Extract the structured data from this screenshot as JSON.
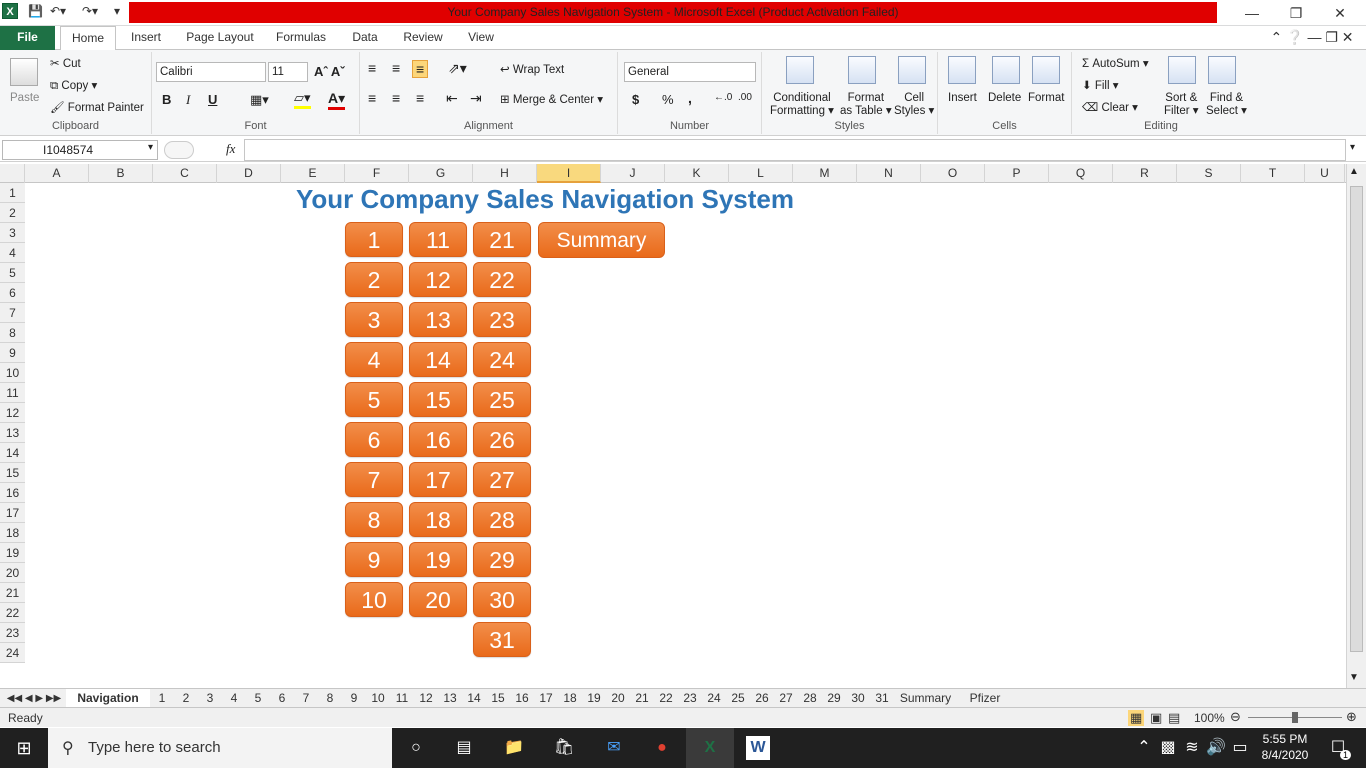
{
  "window": {
    "title": "Your Company Sales Navigation System  -  Microsoft Excel (Product Activation Failed)"
  },
  "tabs": [
    "File",
    "Home",
    "Insert",
    "Page Layout",
    "Formulas",
    "Data",
    "Review",
    "View"
  ],
  "ribbon": {
    "clipboard": {
      "label": "Clipboard",
      "paste": "Paste",
      "cut": "Cut",
      "copy": "Copy",
      "format_painter": "Format Painter"
    },
    "font": {
      "label": "Font",
      "name": "Calibri",
      "size": "11",
      "bold": "B",
      "italic": "I",
      "underline": "U"
    },
    "alignment": {
      "label": "Alignment",
      "wrap_text": "Wrap Text",
      "merge_center": "Merge & Center"
    },
    "number": {
      "label": "Number",
      "format": "General",
      "currency": "$",
      "percent": "%",
      "comma": ","
    },
    "styles": {
      "label": "Styles",
      "conditional": "Conditional",
      "formatting": "Formatting",
      "format_as": "Format",
      "as_table": "as Table",
      "cell": "Cell",
      "styles": "Styles"
    },
    "cells": {
      "label": "Cells",
      "insert": "Insert",
      "delete": "Delete",
      "format": "Format"
    },
    "editing": {
      "label": "Editing",
      "autosum": "AutoSum",
      "fill": "Fill",
      "clear": "Clear",
      "sort": "Sort &",
      "filter": "Filter",
      "find": "Find &",
      "select": "Select"
    }
  },
  "formula_bar": {
    "name_box": "I1048574",
    "fx": "fx",
    "formula": ""
  },
  "columns": [
    "A",
    "B",
    "C",
    "D",
    "E",
    "F",
    "G",
    "H",
    "I",
    "J",
    "K",
    "L",
    "M",
    "N",
    "O",
    "P",
    "Q",
    "R",
    "S",
    "T",
    "U"
  ],
  "selected_column": "I",
  "rows": [
    "1",
    "2",
    "3",
    "4",
    "5",
    "6",
    "7",
    "8",
    "9",
    "10",
    "11",
    "12",
    "13",
    "14",
    "15",
    "16",
    "17",
    "18",
    "19",
    "20",
    "21",
    "22",
    "23",
    "24"
  ],
  "sheet": {
    "title": "Your Company Sales Navigation System",
    "summary_button": "Summary",
    "col1": [
      "1",
      "2",
      "3",
      "4",
      "5",
      "6",
      "7",
      "8",
      "9",
      "10"
    ],
    "col2": [
      "11",
      "12",
      "13",
      "14",
      "15",
      "16",
      "17",
      "18",
      "19",
      "20"
    ],
    "col3": [
      "21",
      "22",
      "23",
      "24",
      "25",
      "26",
      "27",
      "28",
      "29",
      "30",
      "31"
    ]
  },
  "sheet_tabs": [
    "Navigation",
    "1",
    "2",
    "3",
    "4",
    "5",
    "6",
    "7",
    "8",
    "9",
    "10",
    "11",
    "12",
    "13",
    "14",
    "15",
    "16",
    "17",
    "18",
    "19",
    "20",
    "21",
    "22",
    "23",
    "24",
    "25",
    "26",
    "27",
    "28",
    "29",
    "30",
    "31",
    "Summary",
    "Pfizer"
  ],
  "status": {
    "ready": "Ready",
    "zoom": "100%"
  },
  "taskbar": {
    "search_placeholder": "Type here to search",
    "time": "5:55 PM",
    "date": "8/4/2020",
    "notifications": "1"
  }
}
